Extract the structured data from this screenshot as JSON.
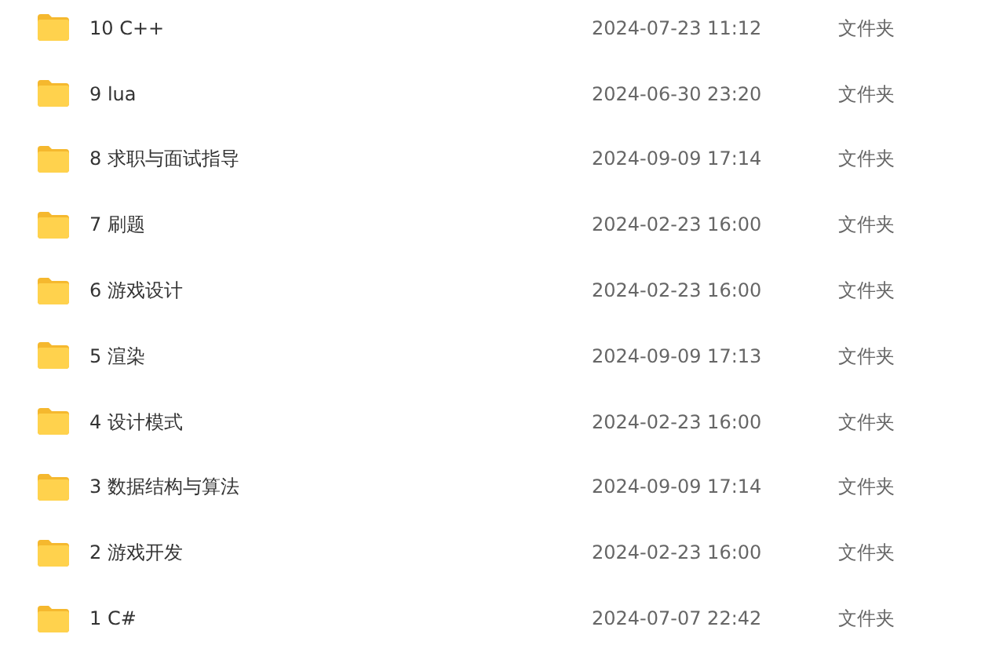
{
  "files": [
    {
      "name": "10 C++",
      "modified": "2024-07-23 11:12",
      "type": "文件夹"
    },
    {
      "name": "9 lua",
      "modified": "2024-06-30 23:20",
      "type": "文件夹"
    },
    {
      "name": "8 求职与面试指导",
      "modified": "2024-09-09 17:14",
      "type": "文件夹"
    },
    {
      "name": "7 刷题",
      "modified": "2024-02-23 16:00",
      "type": "文件夹"
    },
    {
      "name": "6 游戏设计",
      "modified": "2024-02-23 16:00",
      "type": "文件夹"
    },
    {
      "name": "5 渲染",
      "modified": "2024-09-09 17:13",
      "type": "文件夹"
    },
    {
      "name": "4 设计模式",
      "modified": "2024-02-23 16:00",
      "type": "文件夹"
    },
    {
      "name": "3 数据结构与算法",
      "modified": "2024-09-09 17:14",
      "type": "文件夹"
    },
    {
      "name": "2 游戏开发",
      "modified": "2024-02-23 16:00",
      "type": "文件夹"
    },
    {
      "name": "1 C#",
      "modified": "2024-07-07 22:42",
      "type": "文件夹"
    }
  ]
}
